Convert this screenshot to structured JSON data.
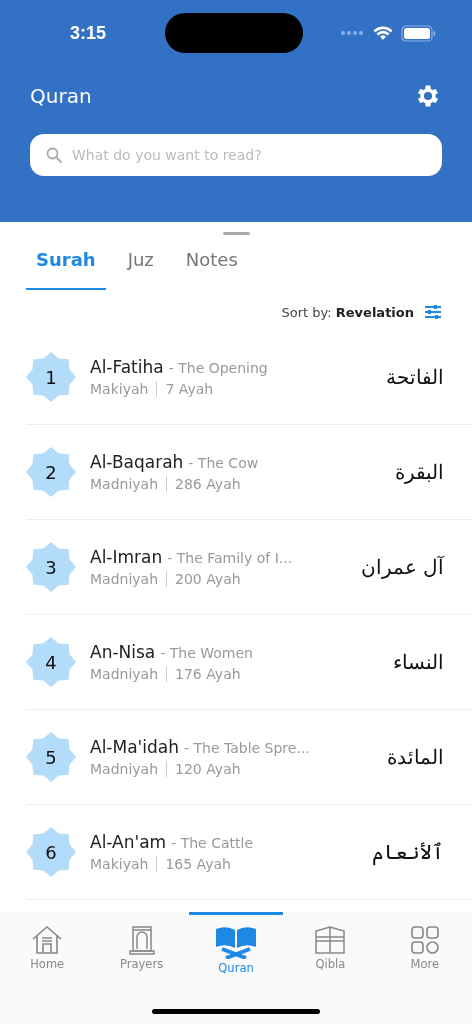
{
  "status_bar": {
    "time": "3:15"
  },
  "header": {
    "title": "Quran"
  },
  "search": {
    "placeholder": "What do you want to read?"
  },
  "tabs": [
    {
      "label": "Surah",
      "selected": true
    },
    {
      "label": "Juz",
      "selected": false
    },
    {
      "label": "Notes",
      "selected": false
    }
  ],
  "sort": {
    "label": "Sort by:",
    "value": "Revelation"
  },
  "surahs": [
    {
      "number": "1",
      "name": "Al-Fatiha",
      "meaning": "- The Opening",
      "type": "Makiyah",
      "ayah": "7 Ayah",
      "arabic": "الفاتحة"
    },
    {
      "number": "2",
      "name": "Al-Baqarah",
      "meaning": "- The Cow",
      "type": "Madniyah",
      "ayah": "286 Ayah",
      "arabic": "البقرة"
    },
    {
      "number": "3",
      "name": "Al-Imran",
      "meaning": "- The Family of I...",
      "type": "Madniyah",
      "ayah": "200 Ayah",
      "arabic": "آل عمران"
    },
    {
      "number": "4",
      "name": "An-Nisa",
      "meaning": "- The Women",
      "type": "Madniyah",
      "ayah": "176 Ayah",
      "arabic": "النساء"
    },
    {
      "number": "5",
      "name": "Al-Ma'idah",
      "meaning": "- The Table Spre...",
      "type": "Madniyah",
      "ayah": "120 Ayah",
      "arabic": "المائدة"
    },
    {
      "number": "6",
      "name": "Al-An'am",
      "meaning": "- The Cattle",
      "type": "Makiyah",
      "ayah": "165 Ayah",
      "arabic": "ٱلأنعام"
    }
  ],
  "bottom_nav": [
    {
      "label": "Home",
      "kind": "home",
      "selected": false
    },
    {
      "label": "Prayers",
      "kind": "prayers",
      "selected": false
    },
    {
      "label": "Quran",
      "kind": "quran",
      "selected": true
    },
    {
      "label": "Qibla",
      "kind": "qibla",
      "selected": false
    },
    {
      "label": "More",
      "kind": "more",
      "selected": false
    }
  ]
}
